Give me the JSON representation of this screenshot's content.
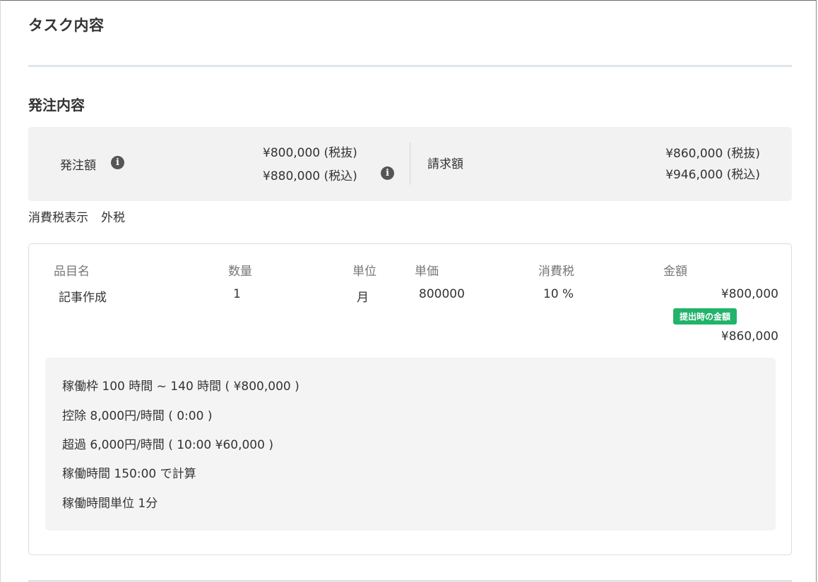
{
  "page": {
    "title": "タスク内容",
    "section_title": "発注内容"
  },
  "summary": {
    "order_label": "発注額",
    "order_ex_tax": "¥800,000 (税抜)",
    "order_in_tax": "¥880,000 (税込)",
    "invoice_label": "請求額",
    "invoice_ex_tax": "¥860,000 (税抜)",
    "invoice_in_tax": "¥946,000 (税込)",
    "info_icon": "info-circle-icon"
  },
  "tax_display": {
    "label": "消費税表示",
    "value": "外税"
  },
  "table": {
    "headers": [
      "品目名",
      "数量",
      "単位",
      "単価",
      "消費税",
      "金額"
    ],
    "rows": [
      {
        "item": "記事作成",
        "quantity": "1",
        "unit": "月",
        "unit_price": "800000",
        "tax": "10 %",
        "amount": "¥800,000",
        "badge": "提出時の金額",
        "submitted_amount": "¥860,000"
      }
    ]
  },
  "details": [
    "稼働枠 100 時間 ~ 140 時間 ( ¥800,000 )",
    "控除 8,000円/時間 ( 0:00 )",
    "超過 6,000円/時間 ( 10:00 ¥60,000 )",
    "稼働時間 150:00 で計算",
    "稼働時間単位 1分"
  ],
  "colors": {
    "badge": "#21b36b",
    "panel": "#f2f2f2",
    "divider": "#dfe5ea"
  }
}
